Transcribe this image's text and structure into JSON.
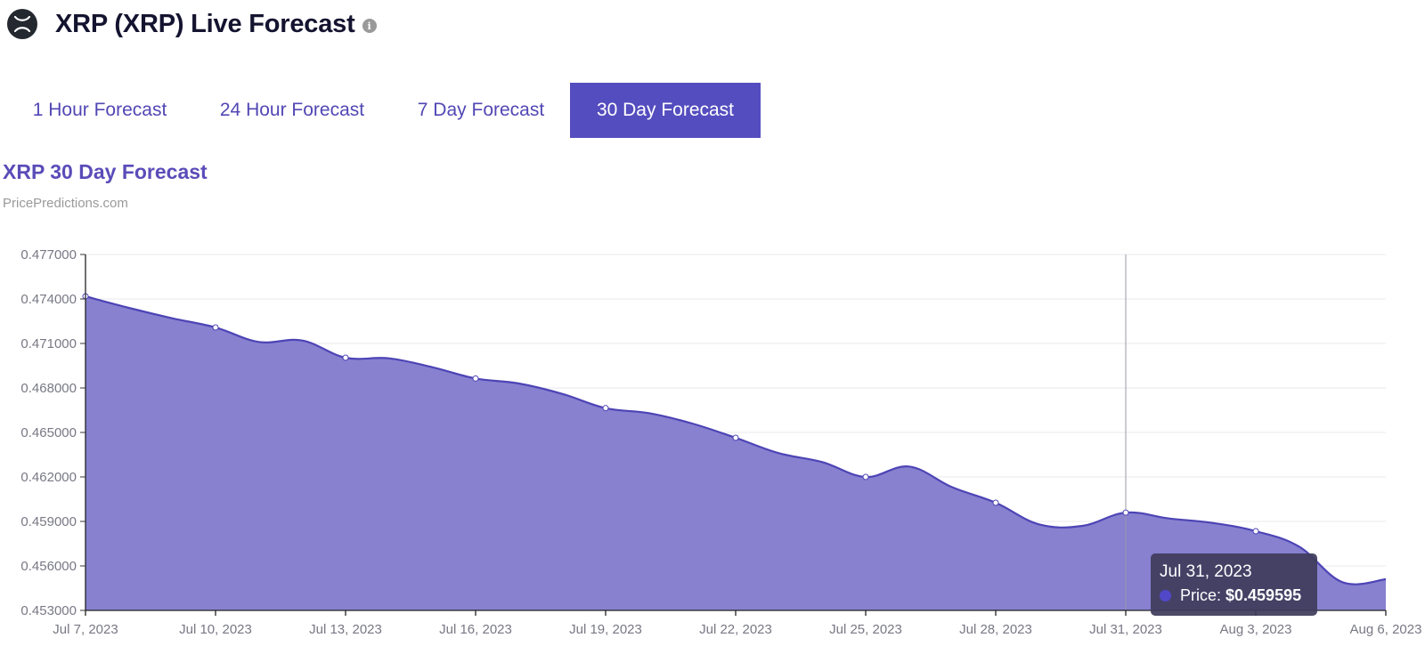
{
  "header": {
    "title": "XRP (XRP) Live Forecast",
    "logo_icon": "xrp-logo-icon",
    "info_icon": "info-icon"
  },
  "tabs": [
    {
      "label": "1 Hour Forecast",
      "active": false
    },
    {
      "label": "24 Hour Forecast",
      "active": false
    },
    {
      "label": "7 Day Forecast",
      "active": false
    },
    {
      "label": "30 Day Forecast",
      "active": true
    }
  ],
  "chart_header": {
    "title": "XRP 30 Day Forecast",
    "source": "PricePredictions.com"
  },
  "colors": {
    "accent": "#544dbf",
    "area_fill": "#8781d0",
    "line": "#4d44b5",
    "tooltip_bg": "#3f3c5c"
  },
  "tooltip": {
    "date": "Jul 31, 2023",
    "label": "Price:",
    "value": "$0.459595"
  },
  "chart_data": {
    "type": "area",
    "title": "XRP 30 Day Forecast",
    "subtitle": "PricePredictions.com",
    "xlabel": "",
    "ylabel": "",
    "series": [
      {
        "name": "Price",
        "x": [
          "Jul 7, 2023",
          "Jul 8, 2023",
          "Jul 9, 2023",
          "Jul 10, 2023",
          "Jul 11, 2023",
          "Jul 12, 2023",
          "Jul 13, 2023",
          "Jul 14, 2023",
          "Jul 15, 2023",
          "Jul 16, 2023",
          "Jul 17, 2023",
          "Jul 18, 2023",
          "Jul 19, 2023",
          "Jul 20, 2023",
          "Jul 21, 2023",
          "Jul 22, 2023",
          "Jul 23, 2023",
          "Jul 24, 2023",
          "Jul 25, 2023",
          "Jul 26, 2023",
          "Jul 27, 2023",
          "Jul 28, 2023",
          "Jul 29, 2023",
          "Jul 30, 2023",
          "Jul 31, 2023",
          "Aug 1, 2023",
          "Aug 2, 2023",
          "Aug 3, 2023",
          "Aug 4, 2023",
          "Aug 5, 2023",
          "Aug 6, 2023"
        ],
        "values": [
          0.47418,
          0.4734,
          0.4727,
          0.47208,
          0.4711,
          0.4712,
          0.47004,
          0.47,
          0.4694,
          0.46864,
          0.4683,
          0.4676,
          0.46664,
          0.4663,
          0.4656,
          0.46464,
          0.4636,
          0.463,
          0.462,
          0.4627,
          0.4613,
          0.46026,
          0.4588,
          0.4587,
          0.459595,
          0.4592,
          0.4589,
          0.45834,
          0.4573,
          0.4549,
          0.4551
        ]
      }
    ],
    "markers_every_n_days": 3,
    "yticks": [
      "0.453000",
      "0.456000",
      "0.459000",
      "0.462000",
      "0.465000",
      "0.468000",
      "0.471000",
      "0.474000",
      "0.477000"
    ],
    "ytick_values": [
      0.453,
      0.456,
      0.459,
      0.462,
      0.465,
      0.468,
      0.471,
      0.474,
      0.477
    ],
    "xticks": [
      "Jul 7, 2023",
      "Jul 10, 2023",
      "Jul 13, 2023",
      "Jul 16, 2023",
      "Jul 19, 2023",
      "Jul 22, 2023",
      "Jul 25, 2023",
      "Jul 28, 2023",
      "Jul 31, 2023",
      "Aug 3, 2023",
      "Aug 6, 2023"
    ],
    "xtick_day_index": [
      0,
      3,
      6,
      9,
      12,
      15,
      18,
      21,
      24,
      27,
      30
    ],
    "ylim": [
      0.453,
      0.477
    ],
    "xlim_day_index": [
      0,
      30
    ],
    "grid": true,
    "hover_index": 24
  }
}
